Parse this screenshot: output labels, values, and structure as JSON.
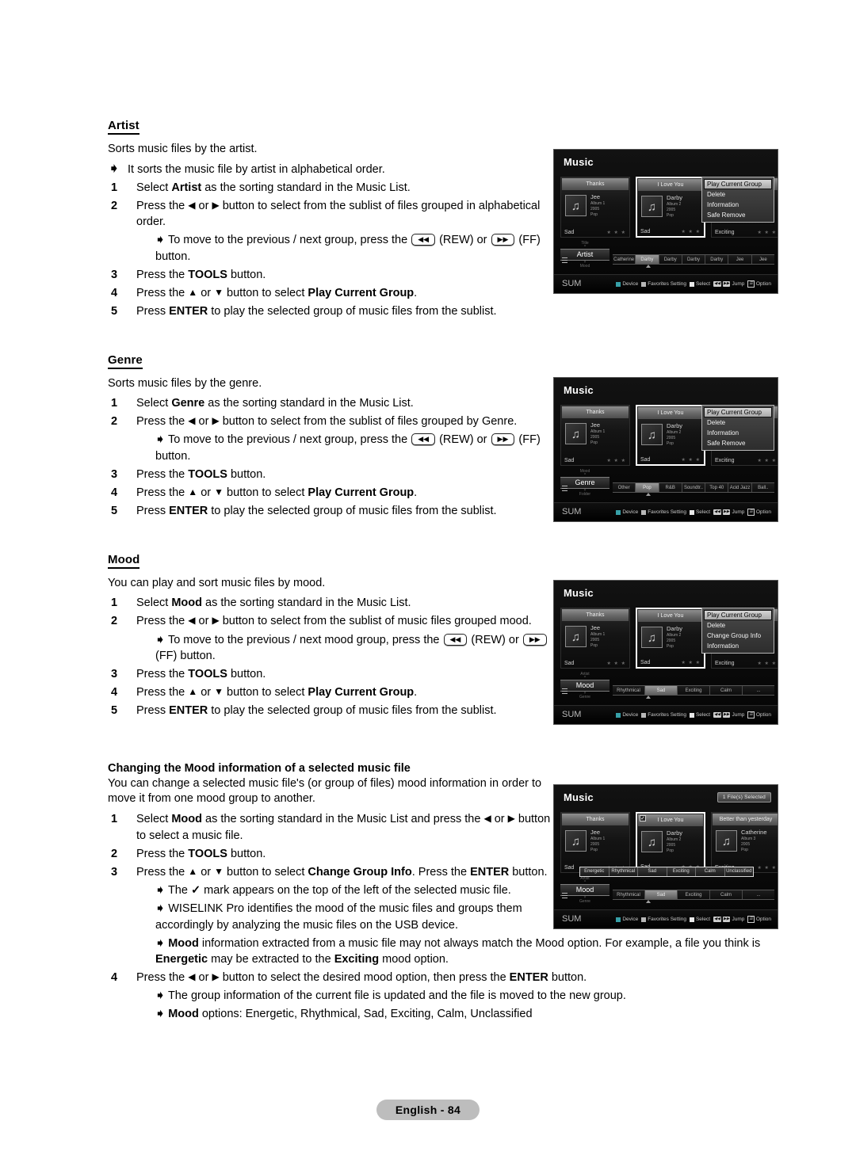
{
  "document": {
    "page_badge": "English - 84"
  },
  "sections": {
    "artist": {
      "title": "Artist",
      "lead": "Sorts music files by the artist.",
      "note_top": "It sorts the music file by artist in alphabetical order.",
      "steps": [
        {
          "num": "1",
          "html": "Select <b>Artist</b> as the sorting standard in the Music List."
        },
        {
          "num": "2",
          "html": "Press the <span class=\"tri\">&#9664;</span> or <span class=\"tri\">&#9654;</span> button to select from the sublist of files grouped in alphabetical order."
        },
        {
          "num": "3",
          "html": "Press the <b>TOOLS</b> button."
        },
        {
          "num": "4",
          "html": "Press the <span class=\"tri\">&#9650;</span> or <span class=\"tri\">&#9660;</span> button to select <b>Play Current Group</b>."
        },
        {
          "num": "5",
          "html": "Press <b>ENTER</b> to play the selected group of music files from the sublist."
        }
      ],
      "note_rew": "To move to the previous / next group, press the <span class=\"key\">&#9664;&#9664;</span> (REW) or <span class=\"key\">&#9654;&#9654;</span> (FF) button."
    },
    "genre": {
      "title": "Genre",
      "lead": "Sorts music files by the genre.",
      "steps": [
        {
          "num": "1",
          "html": "Select <b>Genre</b> as the sorting standard in the Music List."
        },
        {
          "num": "2",
          "html": "Press the <span class=\"tri\">&#9664;</span> or <span class=\"tri\">&#9654;</span> button to select from the sublist of files grouped by Genre."
        },
        {
          "num": "3",
          "html": "Press the <b>TOOLS</b> button."
        },
        {
          "num": "4",
          "html": "Press the <span class=\"tri\">&#9650;</span> or <span class=\"tri\">&#9660;</span> button to select <b>Play Current Group</b>."
        },
        {
          "num": "5",
          "html": "Press <b>ENTER</b> to play the selected group of music files from the sublist."
        }
      ],
      "note_rew": "To move to the previous / next group, press the <span class=\"key\">&#9664;&#9664;</span> (REW) or <span class=\"key\">&#9654;&#9654;</span> (FF) button."
    },
    "mood": {
      "title": "Mood",
      "lead": "You can play and sort music files by mood.",
      "steps": [
        {
          "num": "1",
          "html": "Select <b>Mood</b> as the sorting standard in the Music List."
        },
        {
          "num": "2",
          "html": "Press the <span class=\"tri\">&#9664;</span> or <span class=\"tri\">&#9654;</span> button to select from the sublist of music files grouped mood."
        },
        {
          "num": "3",
          "html": "Press the <b>TOOLS</b> button."
        },
        {
          "num": "4",
          "html": "Press the <span class=\"tri\">&#9650;</span> or <span class=\"tri\">&#9660;</span> button to select <b>Play Current Group</b>."
        },
        {
          "num": "5",
          "html": "Press <b>ENTER</b> to play the selected group of music files from the sublist."
        }
      ],
      "note_rew": "To move to the previous / next mood group, press the <span class=\"key\">&#9664;&#9664;</span> (REW) or <span class=\"key\">&#9654;&#9654;</span> (FF) button."
    },
    "change_mood": {
      "title": "Changing the Mood information of a selected music file",
      "lead": "You can change a selected music file's (or group of files) mood information in order to move it from one mood group to another.",
      "steps": [
        {
          "num": "1",
          "html": "Select <b>Mood</b> as the sorting standard in the Music List and press the <span class=\"tri\">&#9664;</span> or <span class=\"tri\">&#9654;</span> button to select a music file."
        },
        {
          "num": "2",
          "html": "Press the <b>TOOLS</b> button."
        },
        {
          "num": "3",
          "html": "Press the <span class=\"tri\">&#9650;</span> or <span class=\"tri\">&#9660;</span> button to select <b>Change Group Info</b>. Press the <b>ENTER</b> button."
        },
        {
          "num": "4",
          "html": "Press the <span class=\"tri\">&#9664;</span> or <span class=\"tri\">&#9654;</span> button to select the desired mood option, then press the <b>ENTER</b> button."
        }
      ],
      "notes_after_3": [
        "The <span class=\"check-mark\">&#10003;</span> mark appears on the top of the left of the selected music file.",
        "WISELINK Pro identifies the mood of the music files and groups them accordingly by analyzing the music files on the USB device.",
        "<b>Mood</b> information extracted from a music file may not always match the Mood option. For example, a file you think is <b>Energetic</b> may be extracted to the <b>Exciting</b> mood option."
      ],
      "notes_after_4": [
        "The group information of the current file is updated and the file is moved to the new group.",
        "<b>Mood</b> options: Energetic, Rhythmical, Sad, Exciting, Calm, Unclassified"
      ]
    }
  },
  "screenshots": [
    {
      "id": "artist",
      "title": "Music",
      "files_badge": "",
      "cards": [
        {
          "song": "Thanks",
          "artist": "Jee",
          "album": "Album 1",
          "year": "2005",
          "genre": "Pop",
          "mood": "Sad",
          "stars": "★ ★ ★",
          "selected": false,
          "checked": false
        },
        {
          "song": "I Love You",
          "artist": "Darby",
          "album": "Album 2",
          "year": "2005",
          "genre": "Pop",
          "mood": "Sad",
          "stars": "★ ★ ★",
          "selected": true,
          "checked": false
        },
        {
          "song": "",
          "artist": "",
          "album": "",
          "year": "",
          "genre": "",
          "mood": "Exciting",
          "stars": "★ ★ ★",
          "selected": false,
          "checked": false
        }
      ],
      "menu": {
        "items": [
          "Play Current Group",
          "Delete",
          "Information",
          "Safe Remove"
        ],
        "highlighted": 0
      },
      "sort": {
        "above": "Title",
        "current": "Artist",
        "below": "Mood"
      },
      "sublist": [
        "Catherine",
        "Darby",
        "Darby",
        "Darby",
        "Darby",
        "Jee",
        "Jee"
      ],
      "sublist_selected": 1,
      "mood_strip": [],
      "sum_label": "SUM",
      "legend": [
        "Device",
        "Favorites Setting",
        "Select",
        "Jump",
        "Option"
      ]
    },
    {
      "id": "genre",
      "title": "Music",
      "files_badge": "",
      "cards": [
        {
          "song": "Thanks",
          "artist": "Jee",
          "album": "Album 1",
          "year": "2005",
          "genre": "Pop",
          "mood": "Sad",
          "stars": "★ ★ ★",
          "selected": false,
          "checked": false
        },
        {
          "song": "I Love You",
          "artist": "Darby",
          "album": "Album 2",
          "year": "2005",
          "genre": "Pop",
          "mood": "Sad",
          "stars": "★ ★ ★",
          "selected": true,
          "checked": false
        },
        {
          "song": "",
          "artist": "",
          "album": "",
          "year": "",
          "genre": "",
          "mood": "Exciting",
          "stars": "★ ★ ★",
          "selected": false,
          "checked": false
        }
      ],
      "menu": {
        "items": [
          "Play Current Group",
          "Delete",
          "Information",
          "Safe Remove"
        ],
        "highlighted": 0
      },
      "sort": {
        "above": "Mood",
        "current": "Genre",
        "below": "Folder"
      },
      "sublist": [
        "Other",
        "Pop",
        "R&B",
        "Soundtr..",
        "Top 40",
        "Acid Jazz",
        "Ball.."
      ],
      "sublist_selected": 1,
      "mood_strip": [],
      "sum_label": "SUM",
      "legend": [
        "Device",
        "Favorites Setting",
        "Select",
        "Jump",
        "Option"
      ]
    },
    {
      "id": "mood",
      "title": "Music",
      "files_badge": "",
      "cards": [
        {
          "song": "Thanks",
          "artist": "Jee",
          "album": "Album 1",
          "year": "2005",
          "genre": "Pop",
          "mood": "Sad",
          "stars": "★ ★ ★",
          "selected": false,
          "checked": false
        },
        {
          "song": "I Love You",
          "artist": "Darby",
          "album": "Album 2",
          "year": "2005",
          "genre": "Pop",
          "mood": "Sad",
          "stars": "★ ★ ★",
          "selected": true,
          "checked": false
        },
        {
          "song": "",
          "artist": "",
          "album": "",
          "year": "",
          "genre": "",
          "mood": "Exciting",
          "stars": "★ ★ ★",
          "selected": false,
          "checked": false
        }
      ],
      "menu": {
        "items": [
          "Play Current Group",
          "Delete",
          "Change Group Info",
          "Information"
        ],
        "highlighted": 0
      },
      "sort": {
        "above": "Artist",
        "current": "Mood",
        "below": "Genre"
      },
      "sublist": [
        "Rhythmical",
        "Sad",
        "Exciting",
        "Calm",
        "..."
      ],
      "sublist_selected": 1,
      "mood_strip": [],
      "sum_label": "SUM",
      "legend": [
        "Device",
        "Favorites Setting",
        "Select",
        "Jump",
        "Option"
      ]
    },
    {
      "id": "change-mood",
      "title": "Music",
      "files_badge": "1 File(s) Selected",
      "cards": [
        {
          "song": "Thanks",
          "artist": "Jee",
          "album": "Album 1",
          "year": "2005",
          "genre": "Pop",
          "mood": "Sad",
          "stars": "★ ★ ★",
          "selected": false,
          "checked": false
        },
        {
          "song": "I Love You",
          "artist": "Darby",
          "album": "Album 2",
          "year": "2005",
          "genre": "Pop",
          "mood": "Sad",
          "stars": "★ ★ ★",
          "selected": true,
          "checked": true
        },
        {
          "song": "Better than yesterday",
          "artist": "Catherine",
          "album": "Album 3",
          "year": "2005",
          "genre": "Pop",
          "mood": "Exciting",
          "stars": "★ ★ ★",
          "selected": false,
          "checked": false
        }
      ],
      "menu": null,
      "sort": {
        "above": "Artist",
        "current": "Mood",
        "below": "Genre"
      },
      "sublist": [
        "Rhythmical",
        "Sad",
        "Exciting",
        "Calm",
        "..."
      ],
      "sublist_selected": 1,
      "mood_strip": [
        "Energetic",
        "Rhythmical",
        "Sad",
        "Exciting",
        "Calm",
        "Unclassified"
      ],
      "sum_label": "SUM",
      "legend": [
        "Device",
        "Favorites Setting",
        "Select",
        "Jump",
        "Option"
      ]
    }
  ]
}
